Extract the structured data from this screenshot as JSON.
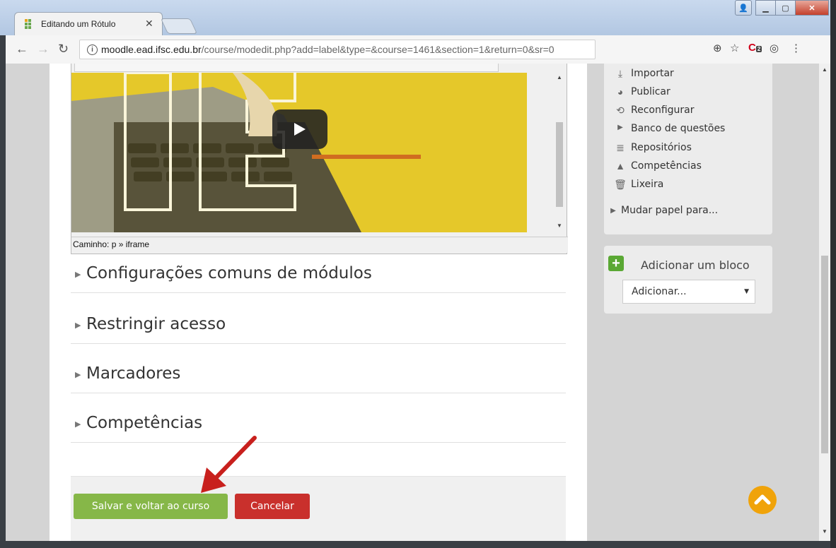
{
  "browser": {
    "tab_title": "Editando um Rótulo",
    "url_host": "moodle.ead.ifsc.edu.br",
    "url_path": "/course/modedit.php?add=label&type=&course=1461&section=1&return=0&sr=0",
    "extension_badge": "2"
  },
  "editor": {
    "path_text": "Caminho: p » iframe"
  },
  "sections": [
    {
      "label": "Configurações comuns de módulos"
    },
    {
      "label": "Restringir acesso"
    },
    {
      "label": "Marcadores"
    },
    {
      "label": "Competências"
    }
  ],
  "buttons": {
    "save": "Salvar e voltar ao curso",
    "cancel": "Cancelar"
  },
  "admin": {
    "items": [
      {
        "label": "Importar",
        "icon": "import-icon"
      },
      {
        "label": "Publicar",
        "icon": "globe-icon"
      },
      {
        "label": "Reconfigurar",
        "icon": "reset-icon"
      },
      {
        "label": "Banco de questões",
        "icon": "triangle-right-icon"
      },
      {
        "label": "Repositórios",
        "icon": "database-icon"
      },
      {
        "label": "Competências",
        "icon": "competency-icon"
      },
      {
        "label": "Lixeira",
        "icon": "trash-icon"
      }
    ],
    "switch_role": "Mudar papel para..."
  },
  "add_block": {
    "title": "Adicionar um bloco",
    "select_value": "Adicionar..."
  },
  "colors": {
    "save_green": "#86b748",
    "cancel_red": "#c9302c",
    "totop_orange": "#f0a30a",
    "annotation_arrow": "#c8201d"
  }
}
